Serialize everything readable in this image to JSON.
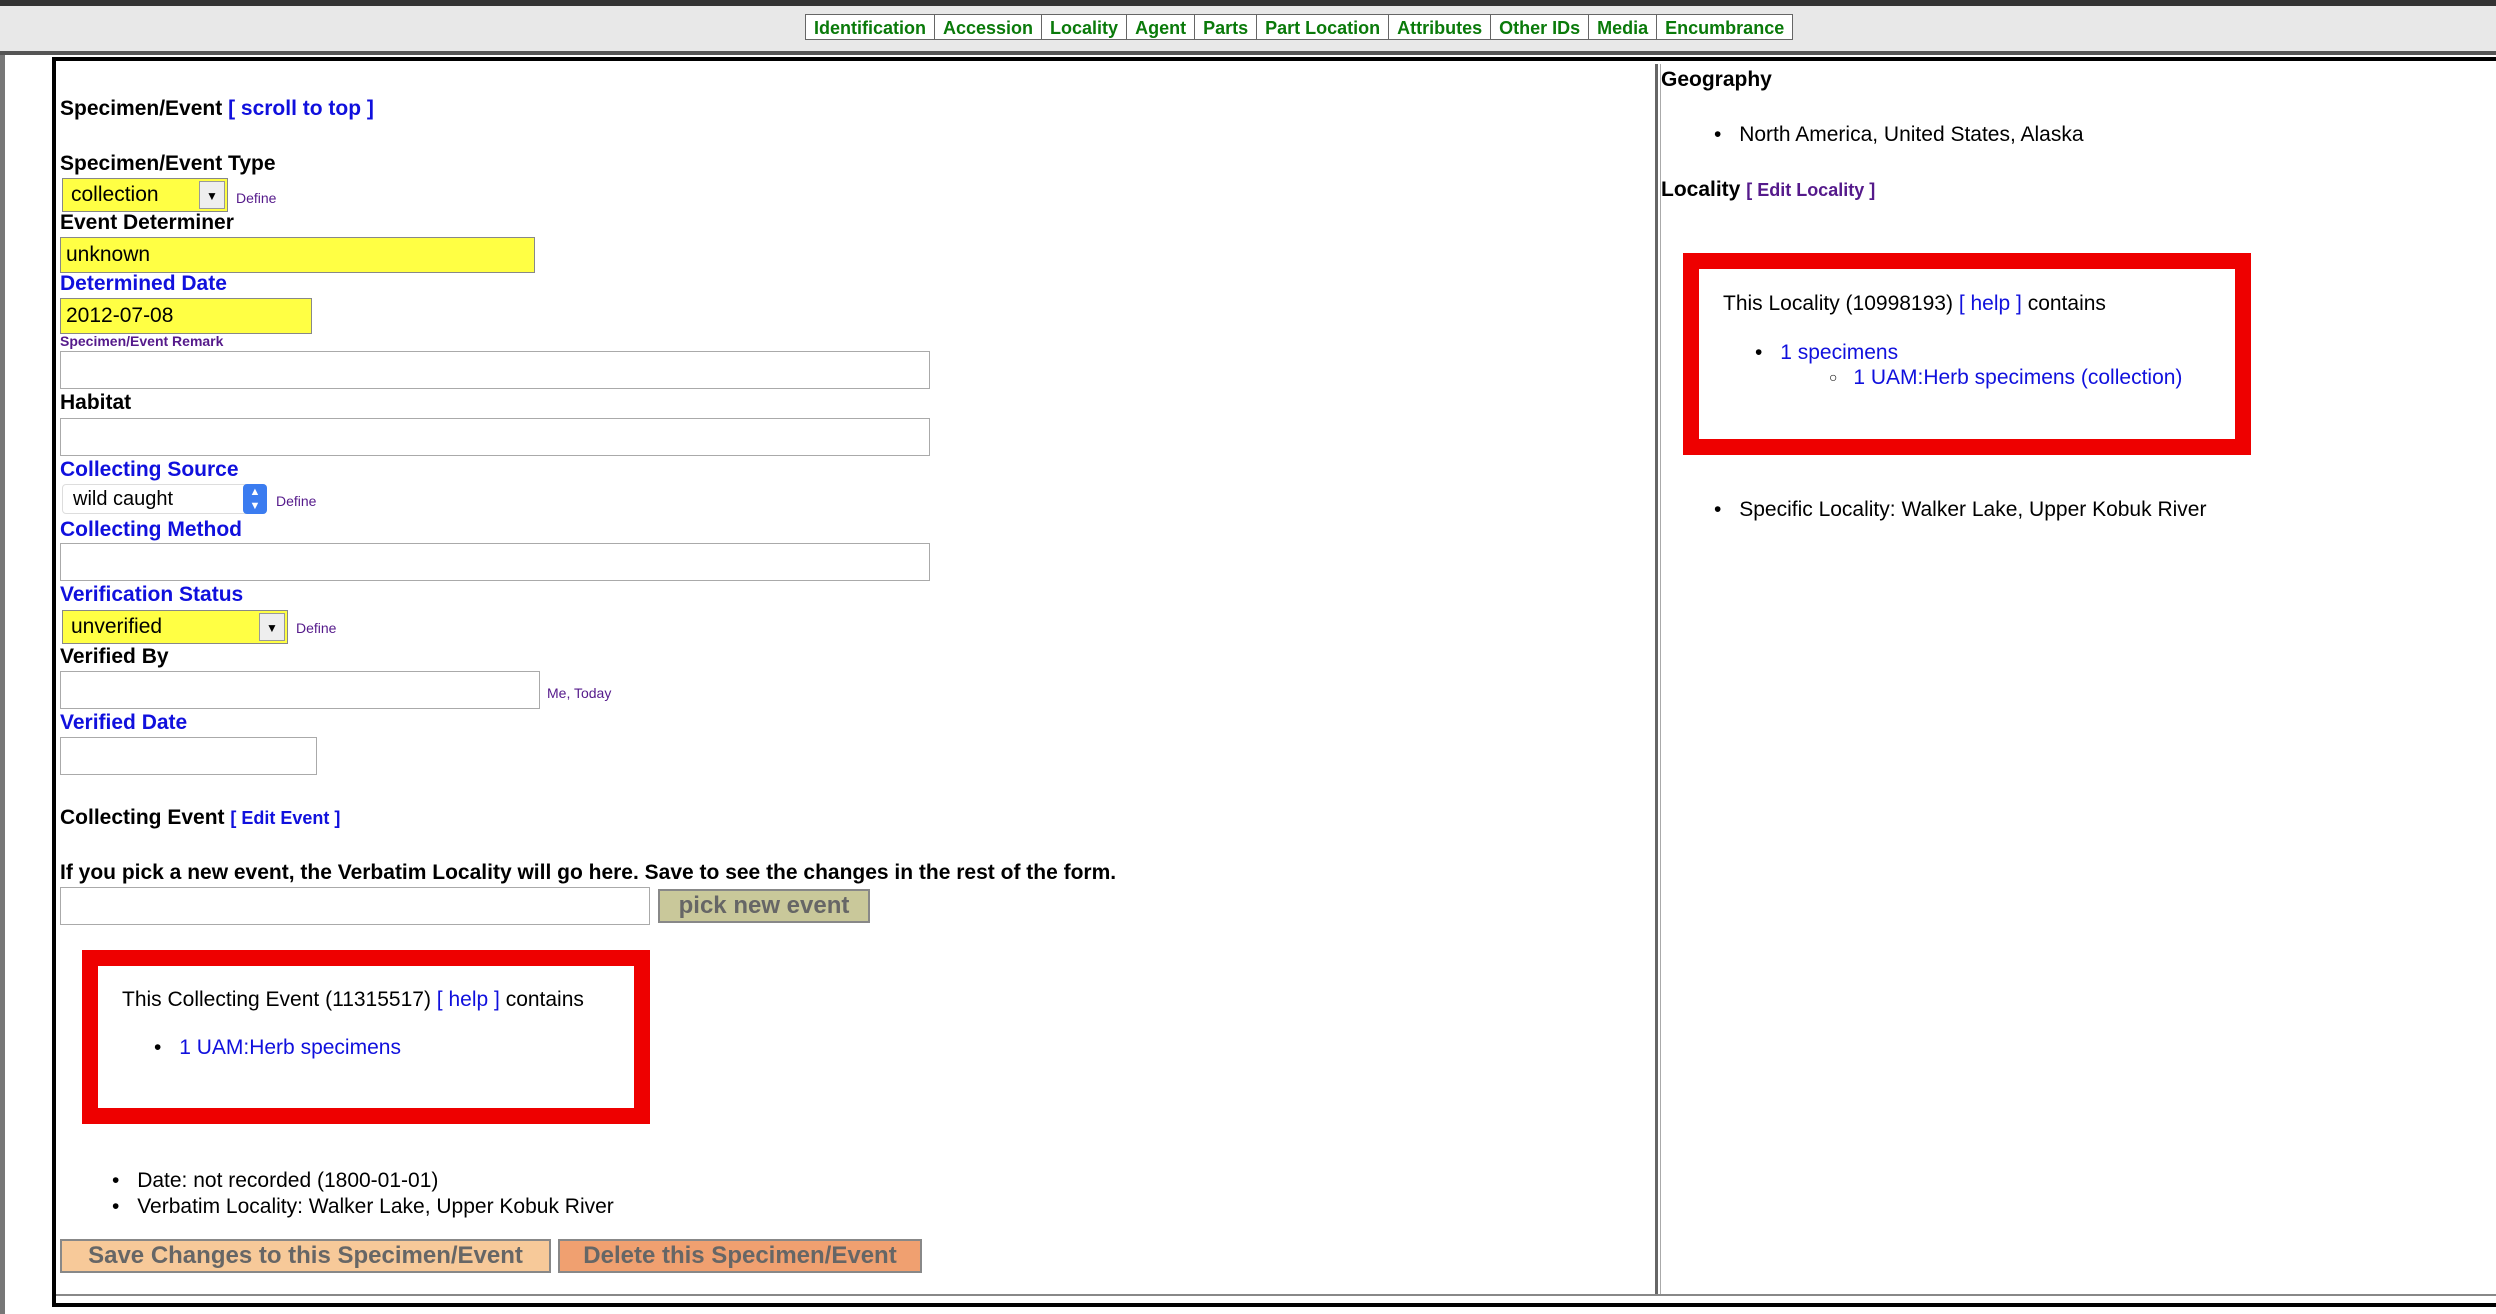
{
  "tabs": [
    "Identification",
    "Accession",
    "Locality",
    "Agent",
    "Parts",
    "Part Location",
    "Attributes",
    "Other IDs",
    "Media",
    "Encumbrance"
  ],
  "specimen_event": {
    "heading": "Specimen/Event",
    "scroll_link": "[ scroll to top ]",
    "type_label": "Specimen/Event Type",
    "type_value": "collection",
    "define": "Define",
    "determiner_label": "Event Determiner",
    "determiner_value": "unknown",
    "determined_date_label": "Determined Date",
    "determined_date_value": "2012-07-08",
    "remark_label": "Specimen/Event Remark",
    "habitat_label": "Habitat",
    "collecting_source_label": "Collecting Source",
    "collecting_source_value": "wild caught",
    "collecting_method_label": "Collecting Method",
    "verification_status_label": "Verification Status",
    "verification_status_value": "unverified",
    "verified_by_label": "Verified By",
    "me_today": "Me, Today",
    "verified_date_label": "Verified Date"
  },
  "collecting_event": {
    "heading": "Collecting Event",
    "edit_link": "[ Edit Event ]",
    "pick_note": "If you pick a new event, the Verbatim Locality will go here. Save to see the changes in the rest of the form.",
    "pick_button": "pick new event",
    "box_text": "This Collecting Event (11315517)",
    "help_link": "[ help ]",
    "contains": "contains",
    "specimens_link": "1 UAM:Herb specimens",
    "date_line": "Date: not recorded (1800-01-01)",
    "verbatim_line": "Verbatim Locality: Walker Lake, Upper Kobuk River"
  },
  "buttons": {
    "save": "Save Changes to this Specimen/Event",
    "delete": "Delete this Specimen/Event"
  },
  "geography": {
    "heading": "Geography",
    "value": "North America, United States, Alaska"
  },
  "locality": {
    "heading": "Locality",
    "edit_link": "[ Edit Locality ]",
    "box_text": "This Locality (10998193)",
    "help_link": "[ help ]",
    "contains": "contains",
    "specimens_link": "1 specimens",
    "sub_link": "1 UAM:Herb specimens (collection)",
    "specific_locality": "Specific Locality: Walker Lake, Upper Kobuk River"
  }
}
